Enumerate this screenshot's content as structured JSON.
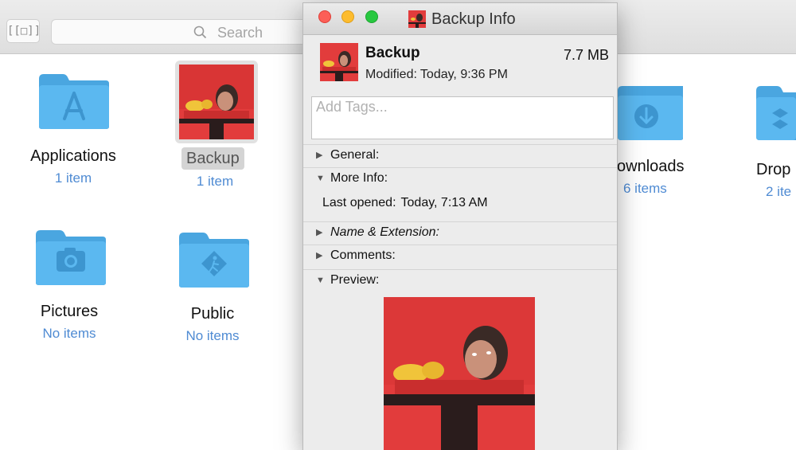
{
  "finder": {
    "toolbar": {
      "view_button": "[[□]]",
      "search_placeholder": "Search"
    },
    "items": [
      {
        "name": "Applications",
        "count": "1 item",
        "icon": "applications-folder-icon"
      },
      {
        "name": "Backup",
        "count": "1 item",
        "icon": "backup-image-thumbnail"
      },
      {
        "name": "ownloads",
        "count": "6 items",
        "icon": "downloads-folder-icon"
      },
      {
        "name": "Drop",
        "count": "2 ite",
        "icon": "dropbox-folder-icon"
      },
      {
        "name": "Pictures",
        "count": "No items",
        "icon": "pictures-folder-icon"
      },
      {
        "name": "Public",
        "count": "No items",
        "icon": "public-folder-icon"
      }
    ]
  },
  "info_window": {
    "title": "Backup Info",
    "name": "Backup",
    "size": "7.7 MB",
    "modified_label": "Modified:",
    "modified_value": "Today, 9:36 PM",
    "tags_placeholder": "Add Tags...",
    "sections": {
      "general": "General:",
      "more_info": "More Info:",
      "last_opened_label": "Last opened:",
      "last_opened_value": "Today, 7:13 AM",
      "name_extension": "Name & Extension:",
      "comments": "Comments:",
      "preview": "Preview:"
    },
    "collapsed_glyph": "▶",
    "expanded_glyph": "▼"
  },
  "colors": {
    "folder": "#5bb8f0",
    "folder_dark": "#4aa6e0",
    "count_text": "#4f8bd3",
    "photo_red": "#e23c3c"
  }
}
